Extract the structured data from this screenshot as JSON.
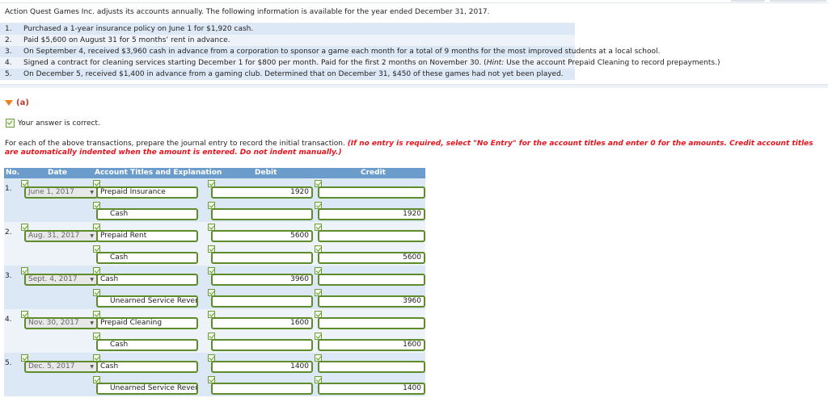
{
  "intro": "Action Quest Games Inc. adjusts its accounts annually. The following information is available for the year ended December 31, 2017.",
  "transactions": [
    {
      "num": "1.",
      "text": "Purchased a 1-year insurance policy on June 1 for $1,920 cash."
    },
    {
      "num": "2.",
      "text": "Paid $5,600 on August 31 for 5 months’ rent in advance."
    },
    {
      "num": "3.",
      "text": "On September 4, received $3,960 cash in advance from a corporation to sponsor a game each month for a total of 9 months for the most improved students at a local school."
    },
    {
      "num": "4.",
      "text_before": "Signed a contract for cleaning services starting December 1 for $800 per month. Paid for the first 2 months on November 30. (",
      "hint_label": "Hint:",
      "text_after": " Use the account Prepaid Cleaning to record prepayments.)"
    },
    {
      "num": "5.",
      "text": "On December 5, received $1,400 in advance from a gaming club. Determined that on December 31, $450 of these games had not yet been played."
    }
  ],
  "part": {
    "label": "(a)",
    "icon": "triangle-down-icon"
  },
  "status": {
    "text": "Your answer is correct.",
    "icon": "check-icon"
  },
  "instructions": {
    "plain": "For each of the above transactions, prepare the journal entry to record the initial transaction. ",
    "emphasis": "(If no entry is required, select \"No Entry\" for the account titles and enter 0 for the amounts. Credit account titles are automatically indented when the amount is entered. Do not indent manually.)"
  },
  "table": {
    "headers": {
      "no": "No.",
      "date": "Date",
      "account": "Account Titles and Explanation",
      "debit": "Debit",
      "credit": "Credit"
    },
    "entries": [
      {
        "no": "1.",
        "date": "June 1, 2017",
        "lines": [
          {
            "account": "Prepaid Insurance",
            "debit": "1920",
            "credit": ""
          },
          {
            "account": "Cash",
            "debit": "",
            "credit": "1920"
          }
        ]
      },
      {
        "no": "2.",
        "date": "Aug. 31, 2017",
        "lines": [
          {
            "account": "Prepaid Rent",
            "debit": "5600",
            "credit": ""
          },
          {
            "account": "Cash",
            "debit": "",
            "credit": "5600"
          }
        ]
      },
      {
        "no": "3.",
        "date": "Sept. 4, 2017",
        "lines": [
          {
            "account": "Cash",
            "debit": "3960",
            "credit": ""
          },
          {
            "account": "Unearned Service Rever",
            "debit": "",
            "credit": "3960"
          }
        ]
      },
      {
        "no": "4.",
        "date": "Nov. 30, 2017",
        "lines": [
          {
            "account": "Prepaid Cleaning",
            "debit": "1600",
            "credit": ""
          },
          {
            "account": "Cash",
            "debit": "",
            "credit": "1600"
          }
        ]
      },
      {
        "no": "5.",
        "date": "Dec. 5, 2017",
        "lines": [
          {
            "account": "Cash",
            "debit": "1400",
            "credit": ""
          },
          {
            "account": "Unearned Service Rever",
            "debit": "",
            "credit": "1400"
          }
        ]
      }
    ]
  },
  "colors": {
    "header_bg": "#6c9ccb",
    "field_border": "#5f8c2b",
    "instruction_red": "#e8141e",
    "part_orange": "#f07f1a"
  }
}
